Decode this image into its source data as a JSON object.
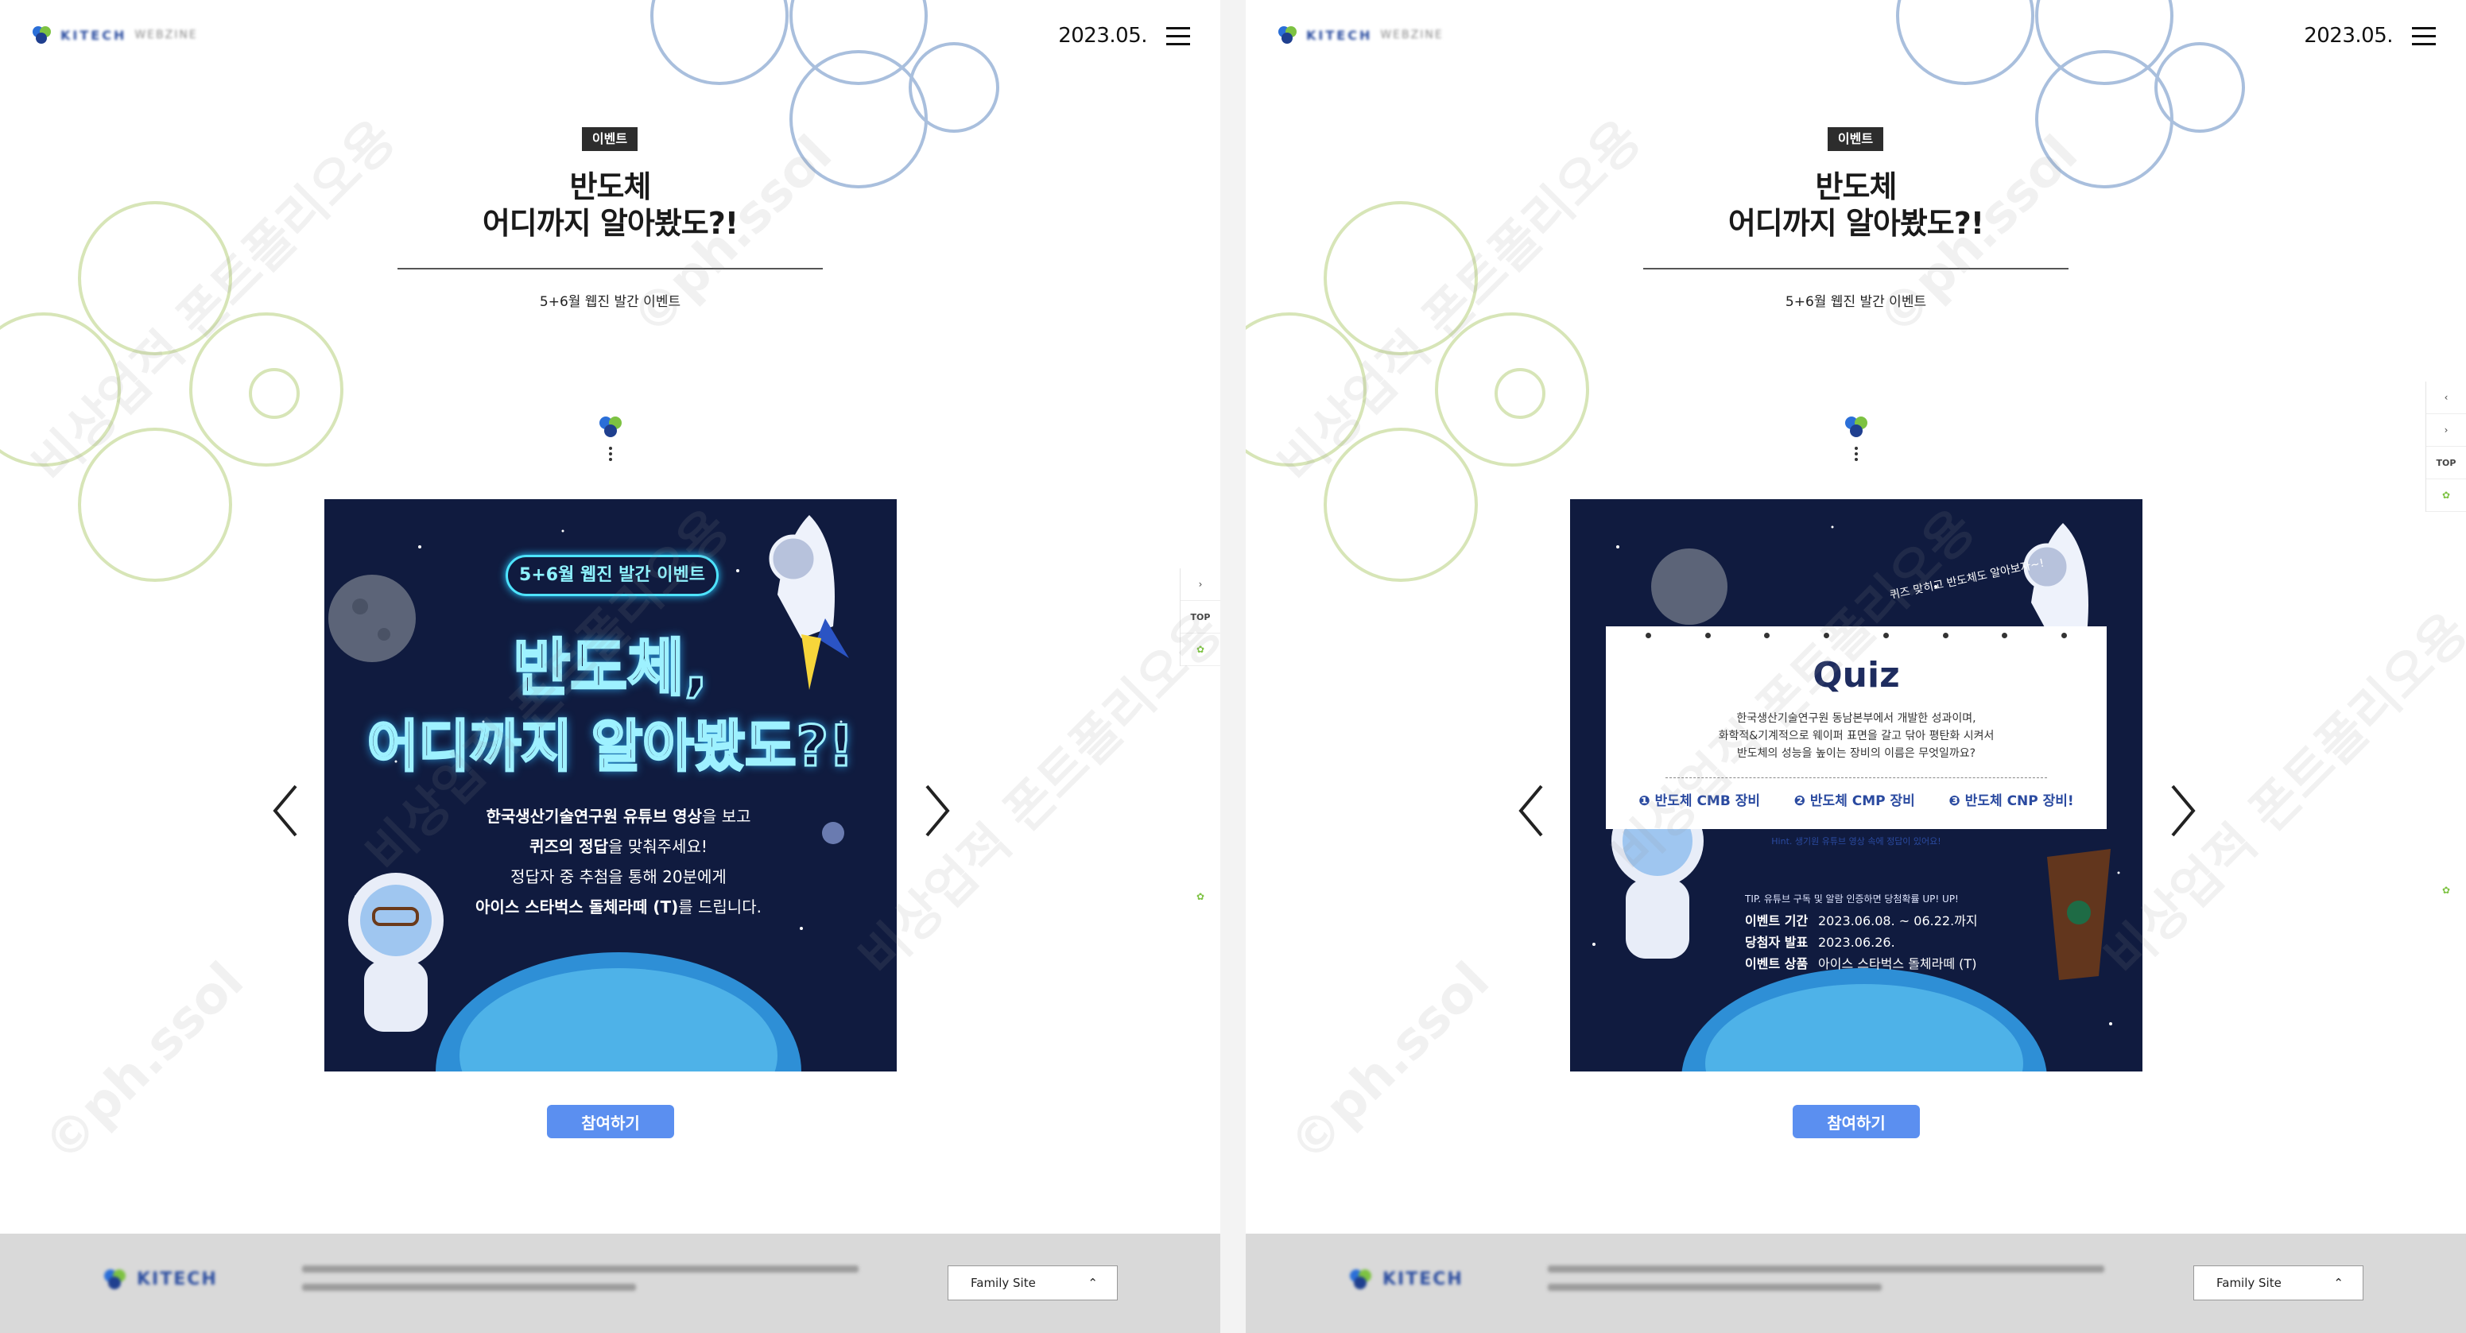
{
  "header": {
    "logo_text": "KITECH",
    "logo_sub": "WEBZINE",
    "date": "2023.05."
  },
  "article": {
    "badge": "이벤트",
    "title_line1": "반도체",
    "title_line2": "어디까지 알아봤도?!",
    "subtitle": "5+6월 웹진 발간 이벤트",
    "join_label": "참여하기"
  },
  "slide1": {
    "badge": "5+6월 웹진 발간 이벤트",
    "neon_line1": "반도체,",
    "neon_line2": "어디까지 알아봤도?!",
    "desc1a": "한국생산기술연구원 유튜브 영상",
    "desc1b": "을 보고",
    "desc2a": "퀴즈의 정답",
    "desc2b": "을 맞춰주세요!",
    "desc3": "정답자 중 추첨을 통해 20분에게",
    "desc4a": "아이스 스타벅스 돌체라떼 (T)",
    "desc4b": "를 드립니다."
  },
  "slide2": {
    "note": "퀴즈 맞히고 반도체도 알아보자~!",
    "quiz_title": "Quiz",
    "question1": "한국생산기술연구원 동남본부에서 개발한 성과이며,",
    "question2": "화학적&기계적으로 웨이퍼 표면을 갈고 닦아 평탄화 시켜서",
    "question3": "반도체의 성능을 높이는 장비의 이름은 무엇일까요?",
    "option1": "❶ 반도체 CMB 장비",
    "option2": "❷ 반도체 CMP 장비",
    "option3": "❸ 반도체 CNP 장비!",
    "hint": "Hint. 생기원 유튜브 영상 속에 정답이 있어요!",
    "tip": "TIP. 유튜브 구독 및 알람 인증하면 당첨확률 UP! UP!",
    "period_label": "이벤트 기간",
    "period_value": "2023.06.08. ~ 06.22.까지",
    "announce_label": "당첨자 발표",
    "announce_value": "2023.06.26.",
    "prize_label": "이벤트 상품",
    "prize_value": "아이스 스타벅스 돌체라떼 (T)"
  },
  "sidebar": {
    "top_label": "TOP"
  },
  "footer": {
    "logo_text": "KITECH",
    "family_site": "Family Site"
  },
  "watermark": {
    "text1": "비상업적 폰트폴리오용",
    "text2": "©ph.ssol"
  },
  "colors": {
    "accent": "#5b8ff0",
    "card_bg": "#101b3f",
    "deco_blue": "#a9bfdd",
    "deco_green": "#d7e5b7",
    "neon": "#4ee4ff"
  }
}
